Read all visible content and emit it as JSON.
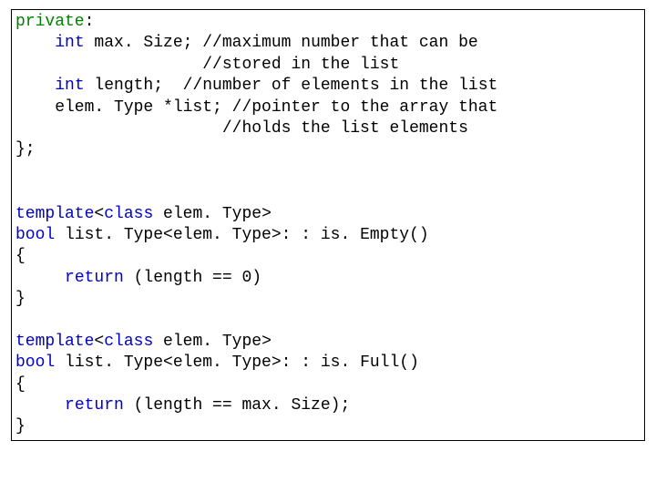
{
  "code": {
    "l01a": "private",
    "l01b": ":",
    "l02a": "    ",
    "l02b": "int",
    "l02c": " max. Size; //maximum number that can be",
    "l03": "                   //stored in the list",
    "l04a": "    ",
    "l04b": "int",
    "l04c": " length;  //number of elements in the list",
    "l05": "    elem. Type *list; //pointer to the array that",
    "l06": "                     //holds the list elements",
    "l07": "};",
    "l08": "",
    "l09": "",
    "l10a": "template",
    "l10b": "<",
    "l10c": "class",
    "l10d": " elem. Type>",
    "l11a": "bool",
    "l11b": " list. Type<elem. Type>: : is. Empty()",
    "l12": "{",
    "l13a": "     ",
    "l13b": "return",
    "l13c": " (length == 0)",
    "l14": "}",
    "l15": "",
    "l16a": "template",
    "l16b": "<",
    "l16c": "class",
    "l16d": " elem. Type>",
    "l17a": "bool",
    "l17b": " list. Type<elem. Type>: : is. Full()",
    "l18": "{",
    "l19a": "     ",
    "l19b": "return",
    "l19c": " (length == max. Size);",
    "l20": "}"
  }
}
